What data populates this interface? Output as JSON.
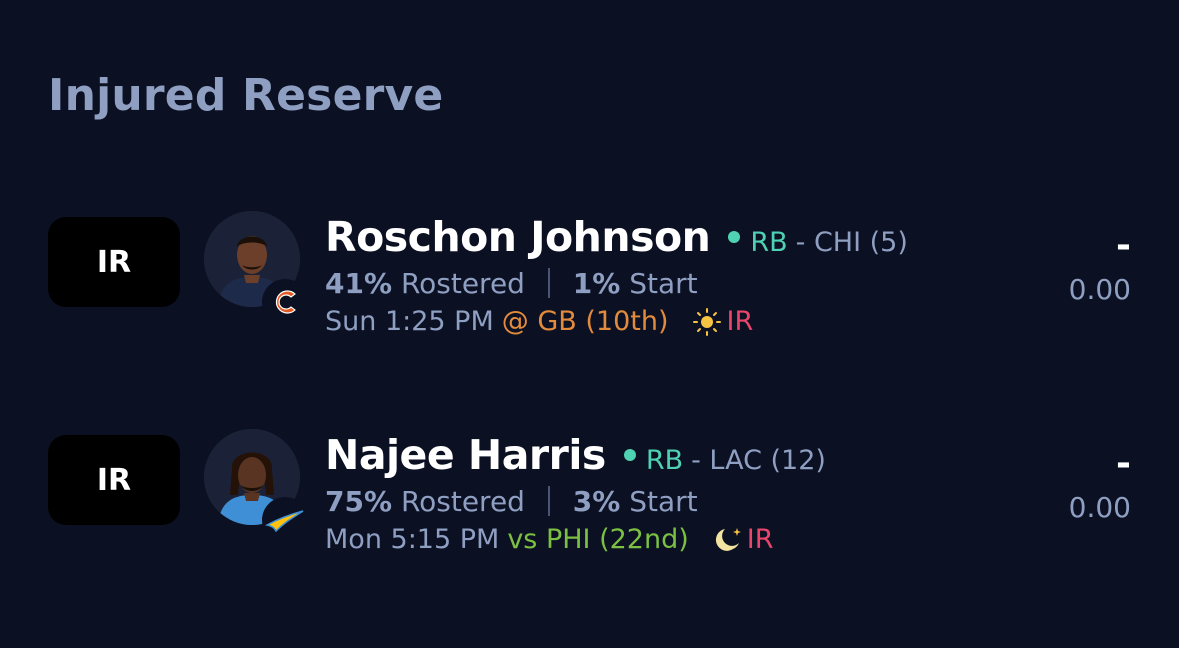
{
  "section": {
    "title": "Injured Reserve"
  },
  "colors": {
    "background": "#0b1022",
    "label": "#8f9fc2",
    "position_green": "#4fd1b3",
    "matchup_orange": "#e38b3c",
    "matchup_green": "#7bc043",
    "injury_red": "#e8466a"
  },
  "players": [
    {
      "slot": "IR",
      "name": "Roschon Johnson",
      "position": "RB",
      "team": "- CHI (5)",
      "rostered_pct": "41%",
      "rostered_label": "Rostered",
      "start_pct": "1%",
      "start_label": "Start",
      "game_time": "Sun 1:25 PM",
      "opponent": "@ GB (10th)",
      "opponent_color": "orange",
      "weather_icon": "sun-icon",
      "injury_status": "IR",
      "projection": "-",
      "points": "0.00",
      "team_logo": "bears-logo"
    },
    {
      "slot": "IR",
      "name": "Najee Harris",
      "position": "RB",
      "team": "- LAC (12)",
      "rostered_pct": "75%",
      "rostered_label": "Rostered",
      "start_pct": "3%",
      "start_label": "Start",
      "game_time": "Mon 5:15 PM",
      "opponent": "vs PHI (22nd)",
      "opponent_color": "green",
      "weather_icon": "moon-icon",
      "injury_status": "IR",
      "projection": "-",
      "points": "0.00",
      "team_logo": "chargers-logo"
    }
  ]
}
